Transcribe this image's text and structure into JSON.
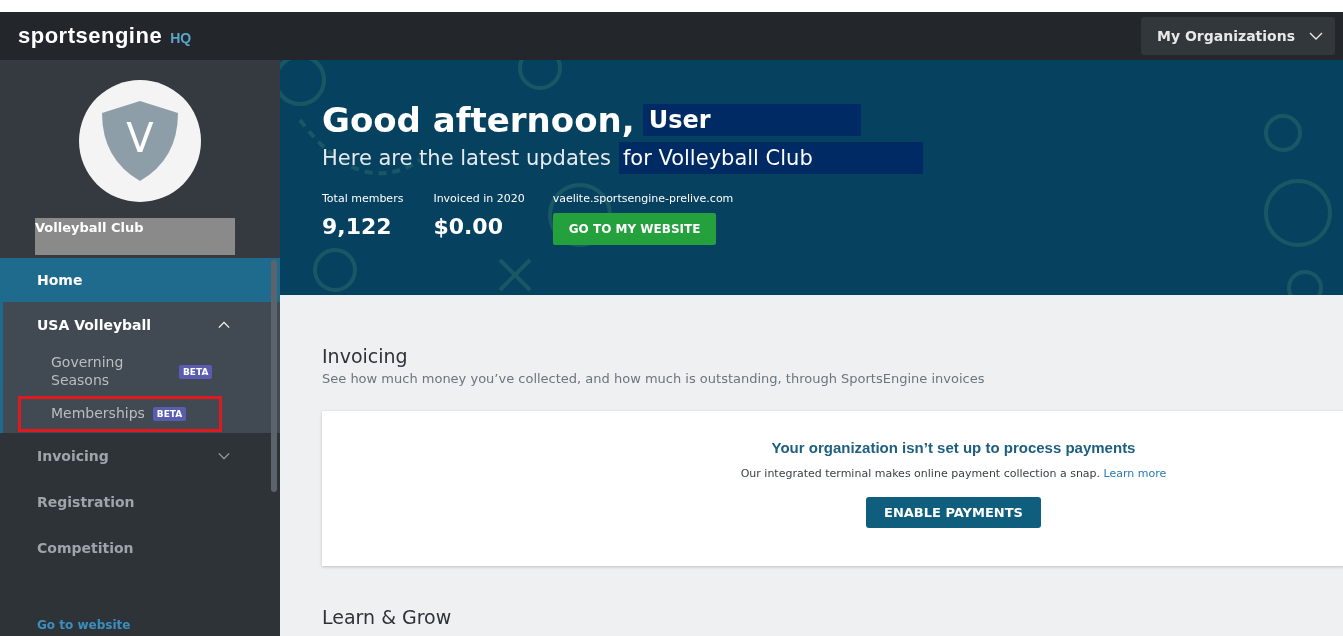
{
  "header": {
    "logo": "sportsengine",
    "logo_suffix": "HQ",
    "org_menu": "My Organizations"
  },
  "sidebar": {
    "org_initial": "V",
    "org_name": "Volleyball Club",
    "items": [
      {
        "label": "Home",
        "selected": true,
        "expanded": false
      },
      {
        "label": "USA Volleyball",
        "selected": false,
        "expanded": true,
        "children": [
          {
            "label": "Governing Seasons",
            "badge": "BETA",
            "annotated": false
          },
          {
            "label": "Memberships",
            "badge": "BETA",
            "annotated": true
          }
        ]
      },
      {
        "label": "Invoicing",
        "selected": false,
        "expanded": false,
        "has_children": true
      },
      {
        "label": "Registration",
        "selected": false,
        "expanded": false
      },
      {
        "label": "Competition",
        "selected": false,
        "expanded": false
      }
    ],
    "footer_link": "Go to website"
  },
  "hero": {
    "greeting": "Good afternoon,",
    "user": "User",
    "subtitle": "Here are the latest updates",
    "org": "for Volleyball Club",
    "stats": [
      {
        "label": "Total members",
        "value": "9,122"
      },
      {
        "label": "Invoiced in 2020",
        "value": "$0.00"
      }
    ],
    "website": "vaelite.sportsengine-prelive.com",
    "website_button": "GO TO MY WEBSITE"
  },
  "invoicing": {
    "title": "Invoicing",
    "description": "See how much money you’ve collected, and how much is outstanding, through SportsEngine invoices",
    "card_title": "Your organization isn’t set up to process payments",
    "card_text": "Our integrated terminal makes online payment collection a snap.",
    "card_link": "Learn more",
    "button": "ENABLE PAYMENTS"
  },
  "next_section": {
    "title": "Learn & Grow"
  }
}
